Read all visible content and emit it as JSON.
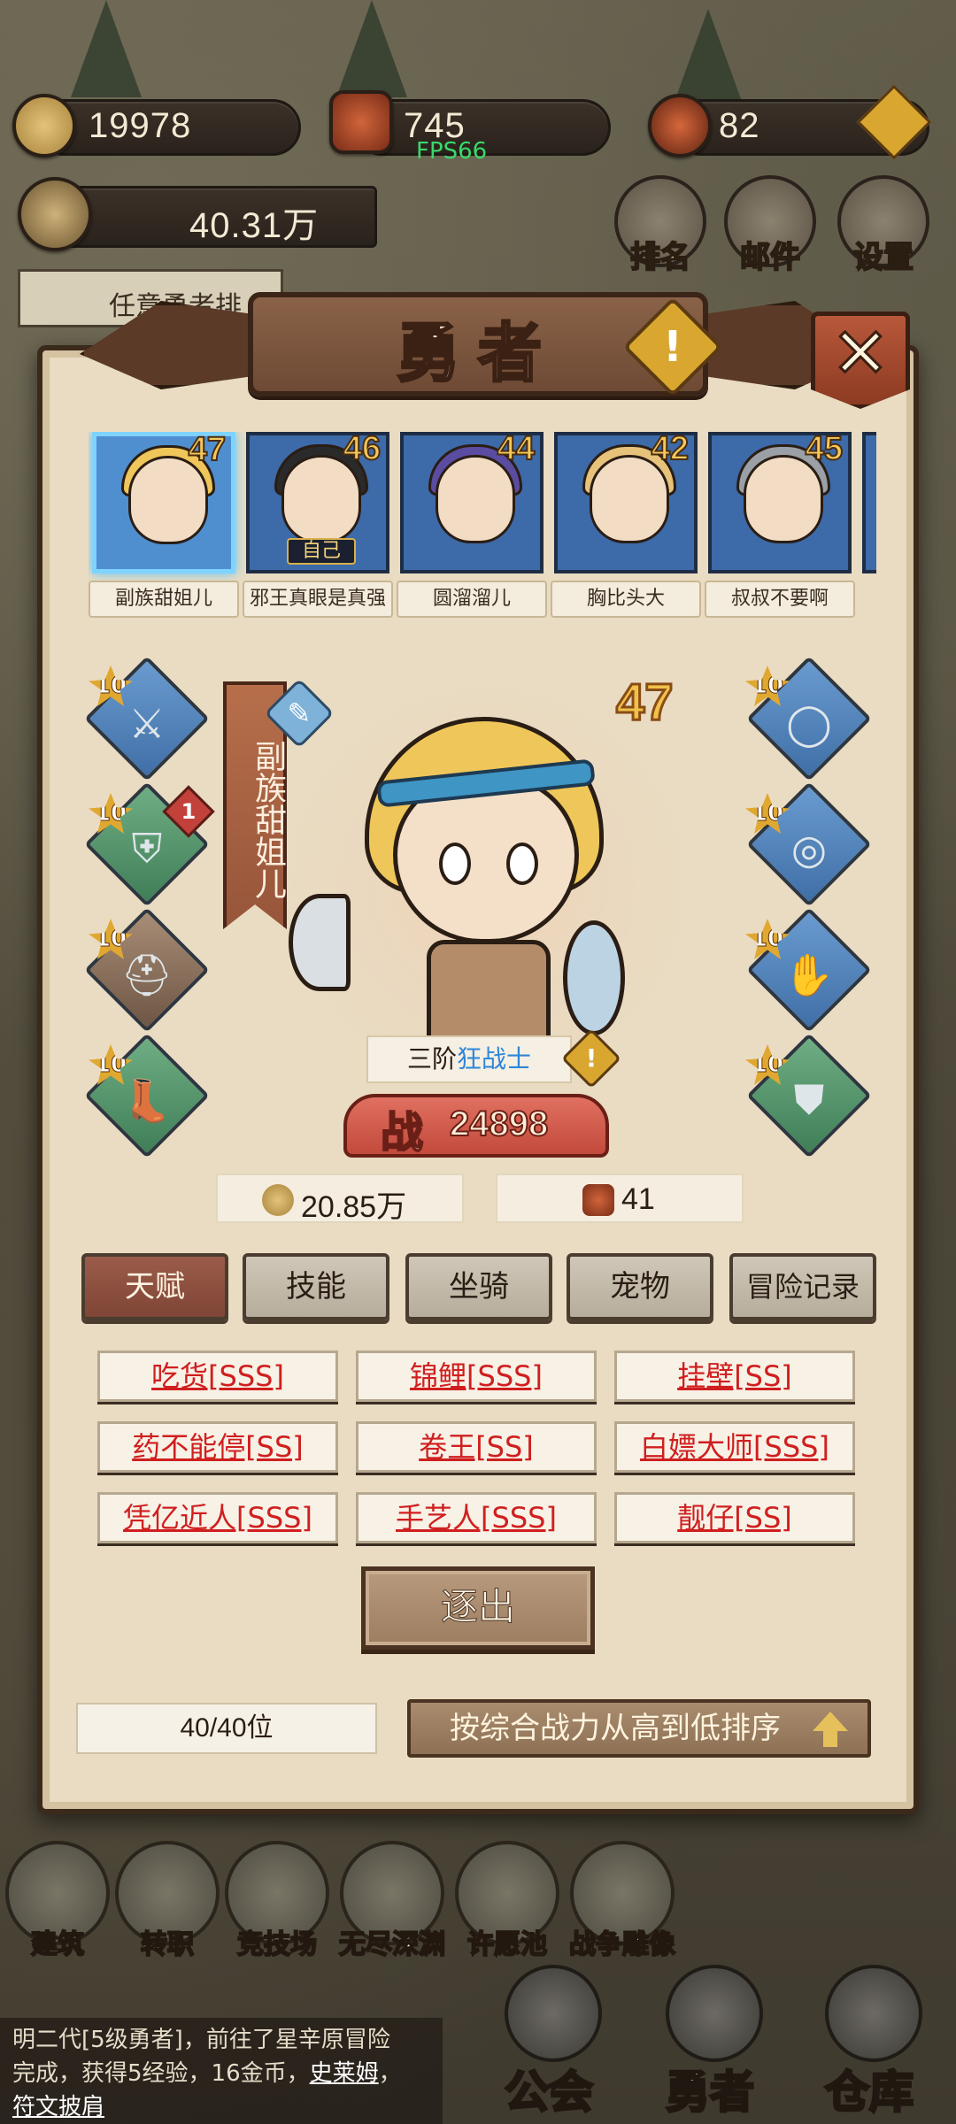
{
  "hud": {
    "gold": "19978",
    "badge_resource": "745",
    "gem_resource": "82",
    "fps": "FPS66",
    "power_total": "40.31万",
    "quest_text": "任意勇者排",
    "buttons": [
      {
        "label": "排名",
        "icon": "trophy-icon"
      },
      {
        "label": "邮件",
        "icon": "mail-icon"
      },
      {
        "label": "设置",
        "icon": "gear-icon"
      }
    ]
  },
  "panel": {
    "title": "勇者",
    "warn_symbol": "!",
    "close_symbol": "✕"
  },
  "heroes": [
    {
      "name": "副族甜姐儿",
      "level": "47",
      "hair": "#efc65a",
      "selected": true,
      "tag": ""
    },
    {
      "name": "邪王真眼是真强",
      "level": "46",
      "hair": "#2a2a2a",
      "selected": false,
      "tag": "自己"
    },
    {
      "name": "圆溜溜儿",
      "level": "44",
      "hair": "#cfc6d8",
      "selected": false,
      "tag": ""
    },
    {
      "name": "胸比头大",
      "level": "42",
      "hair": "#e7c27a",
      "selected": false,
      "tag": ""
    },
    {
      "name": "叔叔不要啊",
      "level": "45",
      "hair": "#9aa0a6",
      "selected": false,
      "tag": ""
    }
  ],
  "hero_detail": {
    "name": "副族甜姐儿",
    "level": "47",
    "class_prefix": "三阶",
    "class_name": "狂战士",
    "power_label": "战",
    "power_value": "24898",
    "gold_stat": "20.85万",
    "badge_stat": "41"
  },
  "equipment": {
    "left": [
      {
        "level": "10",
        "icon": "axe-icon",
        "rarity": "blue",
        "badge": ""
      },
      {
        "level": "10",
        "icon": "armor-icon",
        "rarity": "green",
        "badge": "1"
      },
      {
        "level": "10",
        "icon": "helmet-icon",
        "rarity": "brown",
        "badge": ""
      },
      {
        "level": "10",
        "icon": "boots-icon",
        "rarity": "green",
        "badge": ""
      }
    ],
    "right": [
      {
        "level": "10",
        "icon": "necklace-icon",
        "rarity": "blue",
        "badge": ""
      },
      {
        "level": "10",
        "icon": "ring-icon",
        "rarity": "blue",
        "badge": ""
      },
      {
        "level": "10",
        "icon": "gauntlet-icon",
        "rarity": "blue",
        "badge": ""
      },
      {
        "level": "10",
        "icon": "shield-icon",
        "rarity": "green",
        "badge": ""
      }
    ]
  },
  "tabs": [
    "天赋",
    "技能",
    "坐骑",
    "宠物",
    "冒险记录"
  ],
  "talents": [
    "吃货[SSS]",
    "锦鲤[SSS]",
    "挂壁[SS]",
    "药不能停[SS]",
    "卷王[SS]",
    "白嫖大师[SSS]",
    "凭亿近人[SSS]",
    "手艺人[SSS]",
    "靓仔[SS]"
  ],
  "expel_label": "逐出",
  "roster_count": "40/40位",
  "sort_label": "按综合战力从高到低排序",
  "nav": [
    "建筑",
    "转职",
    "竞技场",
    "无尽深渊",
    "许愿池",
    "战争雕像"
  ],
  "log": {
    "line1": "明二代[5级勇者]，前往了星辛原冒险",
    "line2_prefix": "完成，获得5经验，16金币，",
    "link1": "史莱姆",
    "link2": "符文披肩"
  },
  "main_tabs": [
    "公会",
    "勇者",
    "仓库"
  ],
  "colors": {
    "talent_text": "#d01f1f",
    "class_name": "#2c86d9",
    "level_gold": "#f0c24a",
    "selected_border": "#7fd3ff"
  }
}
